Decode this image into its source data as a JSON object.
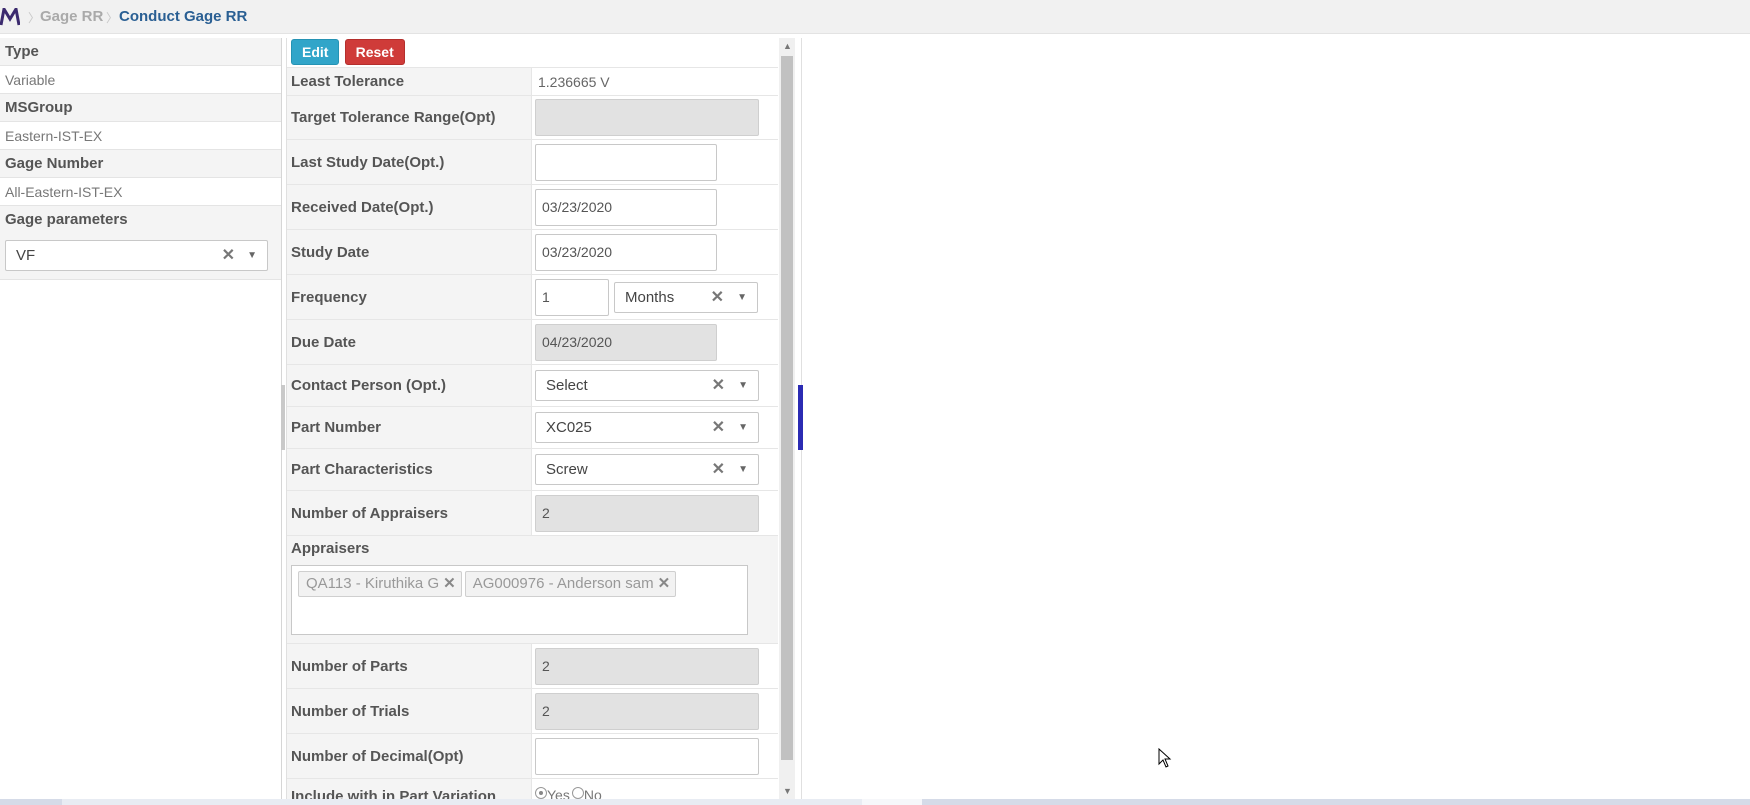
{
  "breadcrumb": {
    "parent": "Gage RR",
    "current": "Conduct Gage RR"
  },
  "left_panel": {
    "type_label": "Type",
    "type_value": "Variable",
    "msgroup_label": "MSGroup",
    "msgroup_value": "Eastern-IST-EX",
    "gage_number_label": "Gage Number",
    "gage_number_value": "All-Eastern-IST-EX",
    "gage_parameters_label": "Gage parameters",
    "gage_parameters_value": "VF"
  },
  "toolbar": {
    "edit_label": "Edit",
    "reset_label": "Reset"
  },
  "form": {
    "least_tolerance": {
      "label": "Least Tolerance",
      "value": "1.236665 V"
    },
    "target_tolerance": {
      "label": "Target Tolerance Range(Opt)",
      "value": ""
    },
    "last_study_date": {
      "label": "Last Study Date(Opt.)",
      "value": ""
    },
    "received_date": {
      "label": "Received Date(Opt.)",
      "value": "03/23/2020"
    },
    "study_date": {
      "label": "Study Date",
      "value": "03/23/2020"
    },
    "frequency": {
      "label": "Frequency",
      "value": "1",
      "unit": "Months"
    },
    "due_date": {
      "label": "Due Date",
      "value": "04/23/2020"
    },
    "contact_person": {
      "label": "Contact Person (Opt.)",
      "value": "Select"
    },
    "part_number": {
      "label": "Part Number",
      "value": "XC025"
    },
    "part_characteristics": {
      "label": "Part Characteristics",
      "value": "Screw"
    },
    "number_of_appraisers": {
      "label": "Number of Appraisers",
      "value": "2"
    },
    "appraisers": {
      "label": "Appraisers",
      "tags": [
        "QA113 - Kiruthika G",
        "AG000976 - Anderson sam"
      ]
    },
    "number_of_parts": {
      "label": "Number of Parts",
      "value": "2"
    },
    "number_of_trials": {
      "label": "Number of Trials",
      "value": "2"
    },
    "number_of_decimal": {
      "label": "Number of Decimal(Opt)",
      "value": ""
    },
    "include_part_variation": {
      "label": "Include with in Part Variation",
      "yes": "Yes",
      "no": "No"
    }
  },
  "icons": {
    "clear": "close-icon",
    "dropdown": "chevron-down-icon",
    "logo": "app-logo"
  },
  "colors": {
    "edit": "#31a5c9",
    "reset": "#cf3b39",
    "breadcrumb_current": "#2a5f93",
    "splitter": "#2b2bb3"
  }
}
